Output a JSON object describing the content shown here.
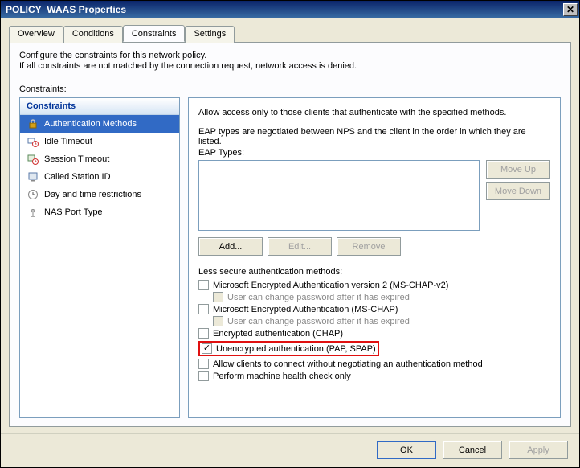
{
  "titlebar": {
    "title": "POLICY_WAAS Properties"
  },
  "tabs": {
    "overview": "Overview",
    "conditions": "Conditions",
    "constraints": "Constraints",
    "settings": "Settings"
  },
  "desc": {
    "line1": "Configure the constraints for this network policy.",
    "line2": "If all constraints are not matched by the connection request, network access is denied."
  },
  "constraints_label": "Constraints:",
  "sidebar": {
    "header": "Constraints",
    "items": [
      {
        "label": "Authentication Methods"
      },
      {
        "label": "Idle Timeout"
      },
      {
        "label": "Session Timeout"
      },
      {
        "label": "Called Station ID"
      },
      {
        "label": "Day and time restrictions"
      },
      {
        "label": "NAS Port Type"
      }
    ]
  },
  "right": {
    "intro": "Allow access only to those clients that authenticate with the specified methods.",
    "eap_desc": "EAP types are negotiated between NPS and the client in the order in which they are listed.",
    "eap_types_label": "EAP Types:",
    "move_up": "Move Up",
    "move_down": "Move Down",
    "add": "Add...",
    "edit": "Edit...",
    "remove": "Remove",
    "less_secure_label": "Less secure authentication methods:",
    "methods": {
      "mschap2": "Microsoft Encrypted Authentication version 2 (MS-CHAP-v2)",
      "mschap2_expired": "User can change password after it has expired",
      "mschap": "Microsoft Encrypted Authentication (MS-CHAP)",
      "mschap_expired": "User can change password after it has expired",
      "chap": "Encrypted authentication (CHAP)",
      "pap": "Unencrypted authentication (PAP, SPAP)",
      "nonego": "Allow clients to connect without negotiating an authentication method",
      "machine_health": "Perform machine health check only"
    }
  },
  "buttons": {
    "ok": "OK",
    "cancel": "Cancel",
    "apply": "Apply"
  }
}
